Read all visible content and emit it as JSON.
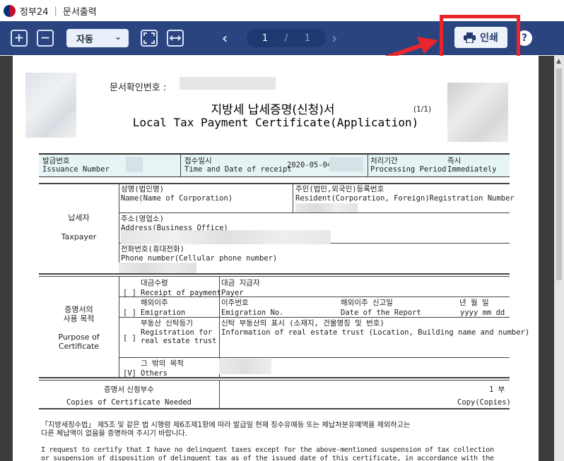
{
  "window": {
    "app_name": "정부24",
    "title": "문서출력"
  },
  "toolbar": {
    "zoom_in_symbol": "+",
    "zoom_out_symbol": "−",
    "zoom_value": "자동",
    "current_page": "1",
    "page_separator": "/",
    "total_pages": "1",
    "print_label": "인쇄",
    "help_symbol": "?"
  },
  "document": {
    "confirm_label": "문서확인번호 :",
    "title_ko": "지방세 납세증명(신청)서",
    "title_en": "Local Tax Payment Certificate(Application)",
    "page_indicator": "(1/1)",
    "meta": {
      "issuance_ko": "발급번호",
      "issuance_en": "Issuance Number",
      "receipt_ko": "접수일시",
      "receipt_en": "Time and Date of receipt",
      "receipt_date": "2020-05-04",
      "processing_ko": "처리기간",
      "processing_en": "Processing Period",
      "processing_value_ko": "즉시",
      "processing_value_en": "Immediately"
    },
    "taxpayer": {
      "label_ko": "납세자",
      "label_en": "Taxpayer",
      "name_ko": "성명(법인명)",
      "name_en": "Name(Name of Corporation)",
      "resident_ko": "주민(법인,외국인)등록번호",
      "resident_en": "Resident(Corporation, Foreign)Registration Number",
      "address_ko": "주소(영업소)",
      "address_en": "Address(Business Office)",
      "phone_ko": "전화번호(휴대전화)",
      "phone_en": "Phone number(Cellular phone number)"
    },
    "purpose": {
      "label_ko_1": "증명서의",
      "label_ko_2": "사용 목적",
      "label_en_1": "Purpose of",
      "label_en_2": "Certificate",
      "receipt_ko": "대금수령",
      "receipt_en": "Receipt of payment",
      "receipt_check": "[ ]",
      "payer_ko": "대금 지급자",
      "payer_en": "Payer",
      "emigration_ko": "해외이주",
      "emigration_en": "Emigration",
      "emigration_check": "[ ]",
      "emig_no_ko": "이주번호",
      "emig_no_en": "Emigration No.",
      "report_date_ko": "해외이주 신고일",
      "report_date_en": "Date of the Report",
      "date_ko": "년 월 일",
      "date_en": "yyyy  mm  dd",
      "trust_ko": "부동산 신탁등기",
      "trust_en_1": "Registration for",
      "trust_en_2": "real estate trust",
      "trust_check": "[ ]",
      "trust_info_ko": "신탁 부동산의 표시 (소재지, 건물명칭 및 번호)",
      "trust_info_en": "Information of real estate trust (Location, Building name and number)",
      "others_ko": "그 밖의 목적",
      "others_en": "Others",
      "others_check": "[V]"
    },
    "copies": {
      "label_ko": "증명서 신청부수",
      "label_en": "Copies of Certificate Needed",
      "count_ko": "1 부",
      "count_en": "Copy(Copies)"
    },
    "statement_ko_1": "「지방세징수법」 제5조 및 같은 법 시행령 제6조제1항에 따라 발급일 현재 징수유예등 또는 체납처분유예액을 제외하고는",
    "statement_ko_2": "다른 체납액이 없음을 증명하여 주시기 바랍니다.",
    "statement_en_1": "  I request to certify that I have no delinquent taxes except for the above-mentioned suspension of tax collection",
    "statement_en_2": "or suspension of disposition of delinquent tax as of the issued date of this certificate, in accordance with the"
  },
  "colors": {
    "toolbar": "#2a4480",
    "highlight": "#e8262c",
    "meta_bg": "#e9f5f7"
  }
}
